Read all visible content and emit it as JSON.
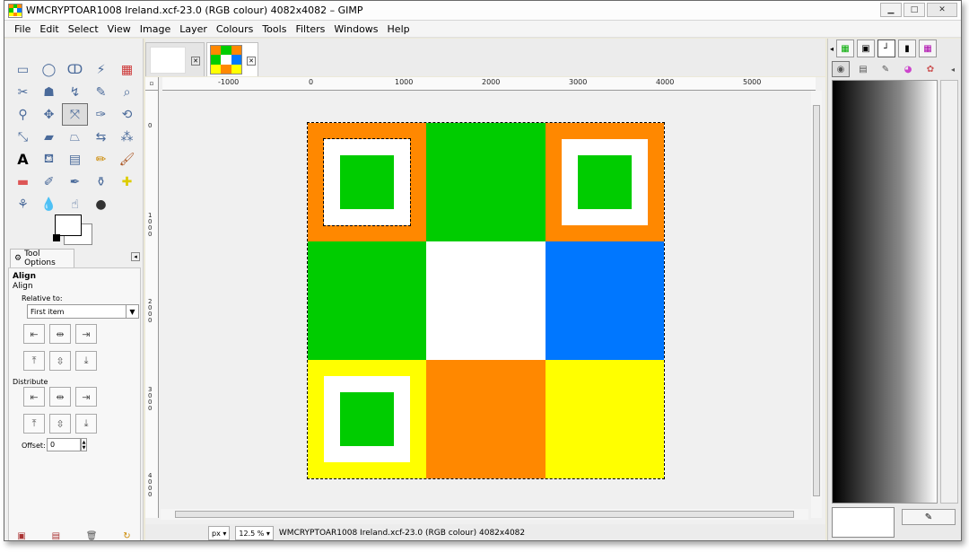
{
  "window": {
    "title": "WMCRYPTOAR1008 Ireland.xcf-23.0 (RGB colour) 4082x4082 – GIMP",
    "minimize": "▁",
    "maximize": "□",
    "close": "✕"
  },
  "menu": [
    "File",
    "Edit",
    "Select",
    "View",
    "Image",
    "Layer",
    "Colours",
    "Tools",
    "Filters",
    "Windows",
    "Help"
  ],
  "tool_options": {
    "tab_label": "Tool Options",
    "title": "Align",
    "subtitle": "Align",
    "relative_label": "Relative to:",
    "relative_value": "First item",
    "distribute_label": "Distribute",
    "offset_label": "Offset:",
    "offset_value": "0"
  },
  "rulers": {
    "h_labels": [
      "-1000",
      "0",
      "1000",
      "2000",
      "3000",
      "4000",
      "5000"
    ],
    "v_labels": [
      "0",
      "1000",
      "2000",
      "3000",
      "4000"
    ]
  },
  "status": {
    "unit": "px",
    "zoom": "12.5 %",
    "description": "WMCRYPTOAR1008 Ireland.xcf-23.0 (RGB colour) 4082x4082"
  },
  "colors": {
    "orange": "#ff8800",
    "green": "#00cc00",
    "white": "#ffffff",
    "blue": "#0077ff",
    "yellow": "#ffff00"
  },
  "image_grid": [
    [
      "orange-frame",
      "green",
      "orange-frame"
    ],
    [
      "green",
      "white",
      "blue"
    ],
    [
      "yellow-frame",
      "orange",
      "yellow"
    ]
  ],
  "icons": {
    "app": "gimp-app-icon",
    "tools": [
      "rect-select-icon",
      "ellipse-select-icon",
      "free-select-icon",
      "fuzzy-select-icon",
      "by-color-select-icon",
      "scissors-icon",
      "foreground-select-icon",
      "paths-icon",
      "color-picker-icon",
      "zoom-icon",
      "measure-icon",
      "move-icon",
      "align-icon",
      "crop-icon",
      "rotate-icon",
      "scale-icon",
      "shear-icon",
      "perspective-icon",
      "flip-icon",
      "cage-icon",
      "text-icon",
      "bucket-fill-icon",
      "blend-icon",
      "pencil-icon",
      "paintbrush-icon",
      "eraser-icon",
      "airbrush-icon",
      "ink-icon",
      "clone-icon",
      "heal-icon",
      "perspective-clone-icon",
      "blur-icon",
      "smudge-icon",
      "dodge-burn-icon"
    ]
  }
}
